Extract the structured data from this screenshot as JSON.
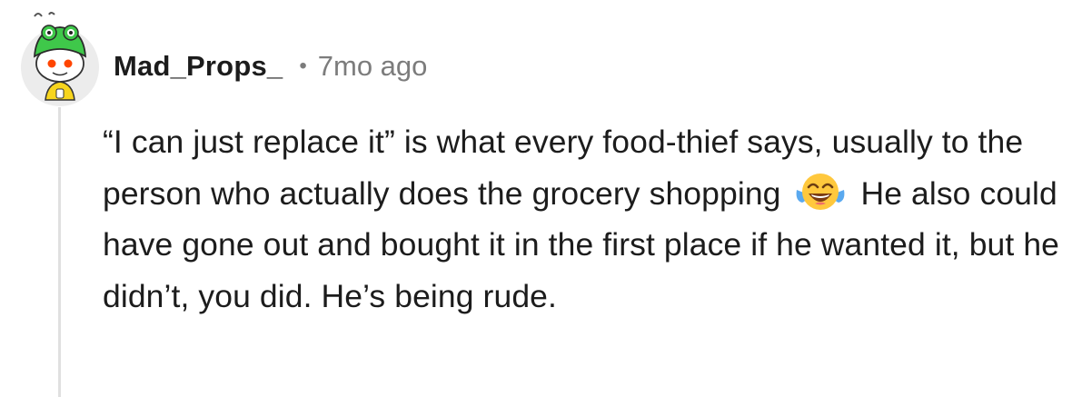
{
  "comment": {
    "author": "Mad_Props_",
    "separator": "•",
    "timestamp": "7mo ago",
    "body_before_emoji": "“I can just replace it” is what every food-thief says, usually to the person who actually does the grocery shopping",
    "emoji": "face-with-tears-of-joy",
    "body_after_emoji": "He also could have gone out and bought it in the first place if he wanted it, but he didn’t, you did. He’s being rude."
  },
  "colors": {
    "text": "#1c1c1c",
    "meta": "#7c7c7c",
    "thread_line": "#e0e0e0",
    "avatar_bg": "#eaeaea",
    "snoo_green": "#3fc84a",
    "snoo_red": "#ff4500"
  }
}
